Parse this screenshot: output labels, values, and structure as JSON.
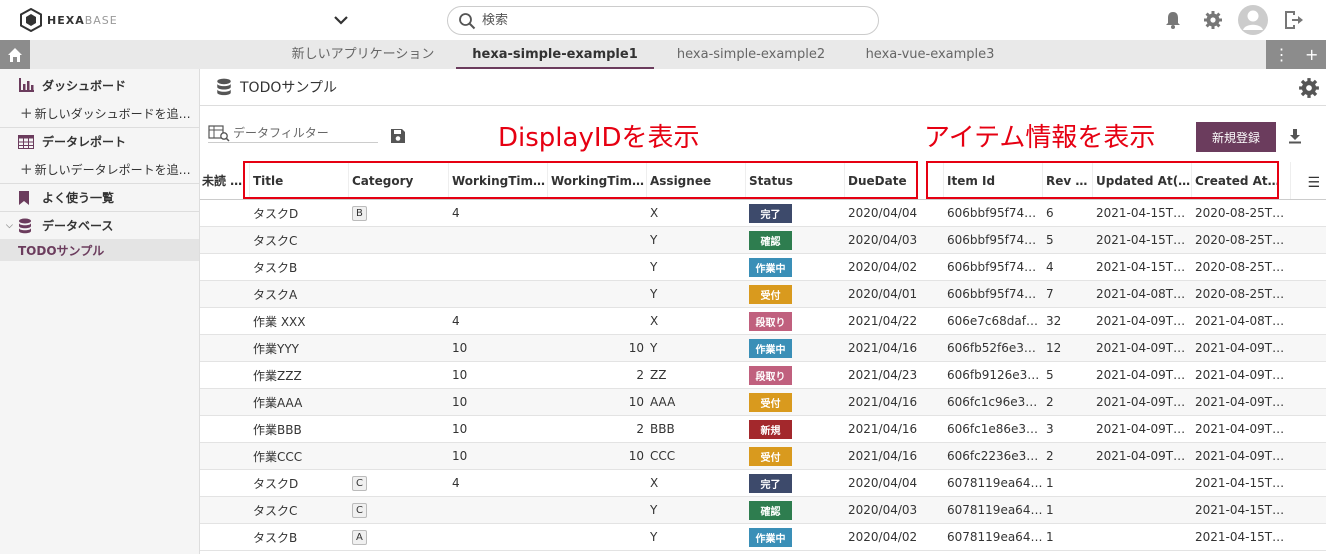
{
  "app": {
    "logo_text": "HEXA",
    "logo_text_light": "BASE",
    "search_placeholder": "検索"
  },
  "tabs": [
    {
      "label": "新しいアプリケーション",
      "active": false
    },
    {
      "label": "hexa-simple-example1",
      "active": true
    },
    {
      "label": "hexa-simple-example2",
      "active": false
    },
    {
      "label": "hexa-vue-example3",
      "active": false
    }
  ],
  "sidebar": {
    "dashboard": "ダッシュボード",
    "new_dashboard": "新しいダッシュボードを追…",
    "data_report": "データレポート",
    "new_data_report": "新しいデータレポートを追…",
    "favorites": "よく使う一覧",
    "database": "データベース",
    "active_item": "TODOサンプル"
  },
  "main": {
    "title": "TODOサンプル",
    "filter_placeholder": "データフィルター",
    "annotation_left": "DisplayIDを表示",
    "annotation_right": "アイテム情報を表示",
    "new_button": "新規登録"
  },
  "columns": {
    "unread": "未読 …",
    "title": "Title",
    "category": "Category",
    "wt1": "WorkingTim…",
    "wt2": "WorkingTim…",
    "assignee": "Assignee",
    "status": "Status",
    "duedate": "DueDate",
    "itemid": "Item Id",
    "rev": "Rev …",
    "updated": "Updated At(…",
    "created": "Created At…"
  },
  "status_colors": {
    "完了": "#3d4a6b",
    "確認": "#2e7d4f",
    "作業中": "#3a8fb7",
    "受付": "#d99a1e",
    "段取り": "#c0607e",
    "新規": "#a3282c"
  },
  "rows": [
    {
      "title": "タスクD",
      "category": "B",
      "wt1": "4",
      "wt2": "",
      "assignee": "X",
      "status": "完了",
      "due": "2020/04/04",
      "itemid": "606bbf95f74…",
      "rev": "6",
      "updated": "2021-04-15T…",
      "created": "2020-08-25T…"
    },
    {
      "title": "タスクC",
      "category": "",
      "wt1": "",
      "wt2": "",
      "assignee": "Y",
      "status": "確認",
      "due": "2020/04/03",
      "itemid": "606bbf95f74…",
      "rev": "5",
      "updated": "2021-04-15T…",
      "created": "2020-08-25T…"
    },
    {
      "title": "タスクB",
      "category": "",
      "wt1": "",
      "wt2": "",
      "assignee": "Y",
      "status": "作業中",
      "due": "2020/04/02",
      "itemid": "606bbf95f74…",
      "rev": "4",
      "updated": "2021-04-15T…",
      "created": "2020-08-25T…"
    },
    {
      "title": "タスクA",
      "category": "",
      "wt1": "",
      "wt2": "",
      "assignee": "Y",
      "status": "受付",
      "due": "2020/04/01",
      "itemid": "606bbf95f74…",
      "rev": "7",
      "updated": "2021-04-08T…",
      "created": "2020-08-25T…"
    },
    {
      "title": "作業 XXX",
      "category": "",
      "wt1": "4",
      "wt2": "",
      "assignee": "X",
      "status": "段取り",
      "due": "2021/04/22",
      "itemid": "606e7c68daf…",
      "rev": "32",
      "updated": "2021-04-09T…",
      "created": "2021-04-08T…"
    },
    {
      "title": "作業YYY",
      "category": "",
      "wt1": "10",
      "wt2": "10",
      "assignee": "Y",
      "status": "作業中",
      "due": "2021/04/16",
      "itemid": "606fb52f6e3…",
      "rev": "12",
      "updated": "2021-04-09T…",
      "created": "2021-04-09T…"
    },
    {
      "title": "作業ZZZ",
      "category": "",
      "wt1": "10",
      "wt2": "2",
      "assignee": "ZZ",
      "status": "段取り",
      "due": "2021/04/23",
      "itemid": "606fb9126e3…",
      "rev": "5",
      "updated": "2021-04-09T…",
      "created": "2021-04-09T…"
    },
    {
      "title": "作業AAA",
      "category": "",
      "wt1": "10",
      "wt2": "10",
      "assignee": "AAA",
      "status": "受付",
      "due": "2021/04/16",
      "itemid": "606fc1c96e3…",
      "rev": "2",
      "updated": "2021-04-09T…",
      "created": "2021-04-09T…"
    },
    {
      "title": "作業BBB",
      "category": "",
      "wt1": "10",
      "wt2": "2",
      "assignee": "BBB",
      "status": "新規",
      "due": "2021/04/16",
      "itemid": "606fc1e86e3…",
      "rev": "3",
      "updated": "2021-04-09T…",
      "created": "2021-04-09T…"
    },
    {
      "title": "作業CCC",
      "category": "",
      "wt1": "10",
      "wt2": "10",
      "assignee": "CCC",
      "status": "受付",
      "due": "2021/04/16",
      "itemid": "606fc2236e3…",
      "rev": "2",
      "updated": "2021-04-09T…",
      "created": "2021-04-09T…"
    },
    {
      "title": "タスクD",
      "category": "C",
      "wt1": "4",
      "wt2": "",
      "assignee": "X",
      "status": "完了",
      "due": "2020/04/04",
      "itemid": "6078119ea64…",
      "rev": "1",
      "updated": "",
      "created": "2021-04-15T…"
    },
    {
      "title": "タスクC",
      "category": "C",
      "wt1": "",
      "wt2": "",
      "assignee": "Y",
      "status": "確認",
      "due": "2020/04/03",
      "itemid": "6078119ea64…",
      "rev": "1",
      "updated": "",
      "created": "2021-04-15T…"
    },
    {
      "title": "タスクB",
      "category": "A",
      "wt1": "",
      "wt2": "",
      "assignee": "Y",
      "status": "作業中",
      "due": "2020/04/02",
      "itemid": "6078119ea64…",
      "rev": "1",
      "updated": "",
      "created": "2021-04-15T…"
    }
  ]
}
